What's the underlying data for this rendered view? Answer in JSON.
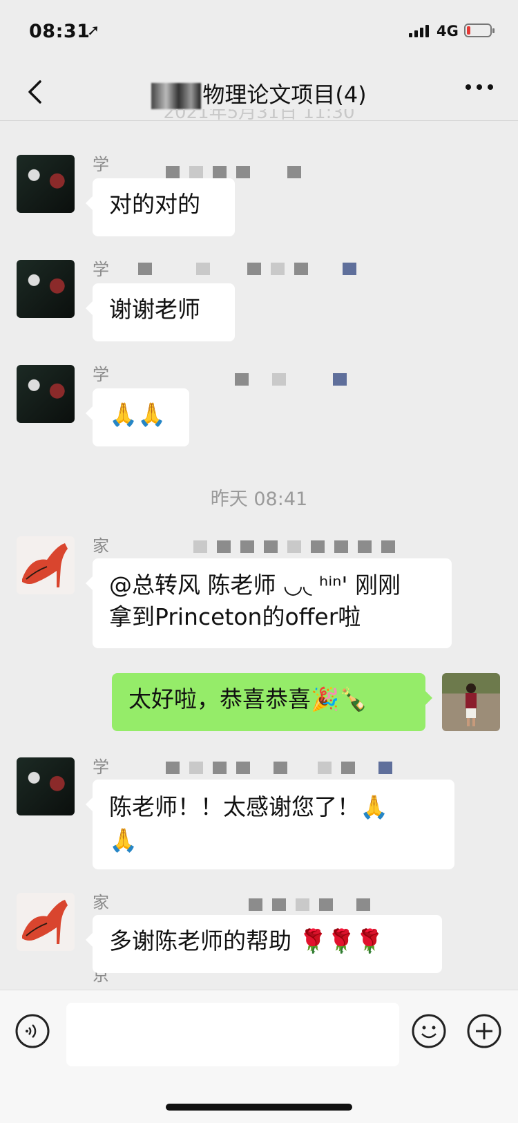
{
  "status_bar": {
    "time": "08:31",
    "location_glyph": "➚",
    "network": "4G",
    "battery_level": 0.15
  },
  "nav": {
    "title": "物理论文项目(4)"
  },
  "ghost_timestamp": "2021年5月31日 11:30",
  "messages": [
    {
      "sender": "学生",
      "text": "对的对的"
    },
    {
      "sender": "学生",
      "text": "谢谢老师"
    },
    {
      "sender": "学生",
      "text": "🙏🙏"
    },
    {
      "timestamp": "昨天 08:41"
    },
    {
      "sender": "家长 北京",
      "text_line1": "@总转风 陈老师 ◡◟ ʰⁱⁿ' 刚刚",
      "text_line2": "拿到Princeton的offer啦"
    },
    {
      "sender": "me",
      "text": "太好啦，恭喜恭喜🎉🍾"
    },
    {
      "sender": "学生",
      "text_line1": "陈老师！！太感谢您了！🙏",
      "text_line2": "🙏"
    },
    {
      "sender": "家长 北京",
      "text": "多谢陈老师的帮助 🌹🌹🌹"
    }
  ],
  "colors": {
    "background": "#ededed",
    "bubble_left": "#ffffff",
    "bubble_right": "#95ec69"
  },
  "icons": {
    "back": "chevron-left-icon",
    "more": "more-icon",
    "voice": "voice-icon",
    "emoji": "emoji-icon",
    "plus": "plus-icon"
  }
}
